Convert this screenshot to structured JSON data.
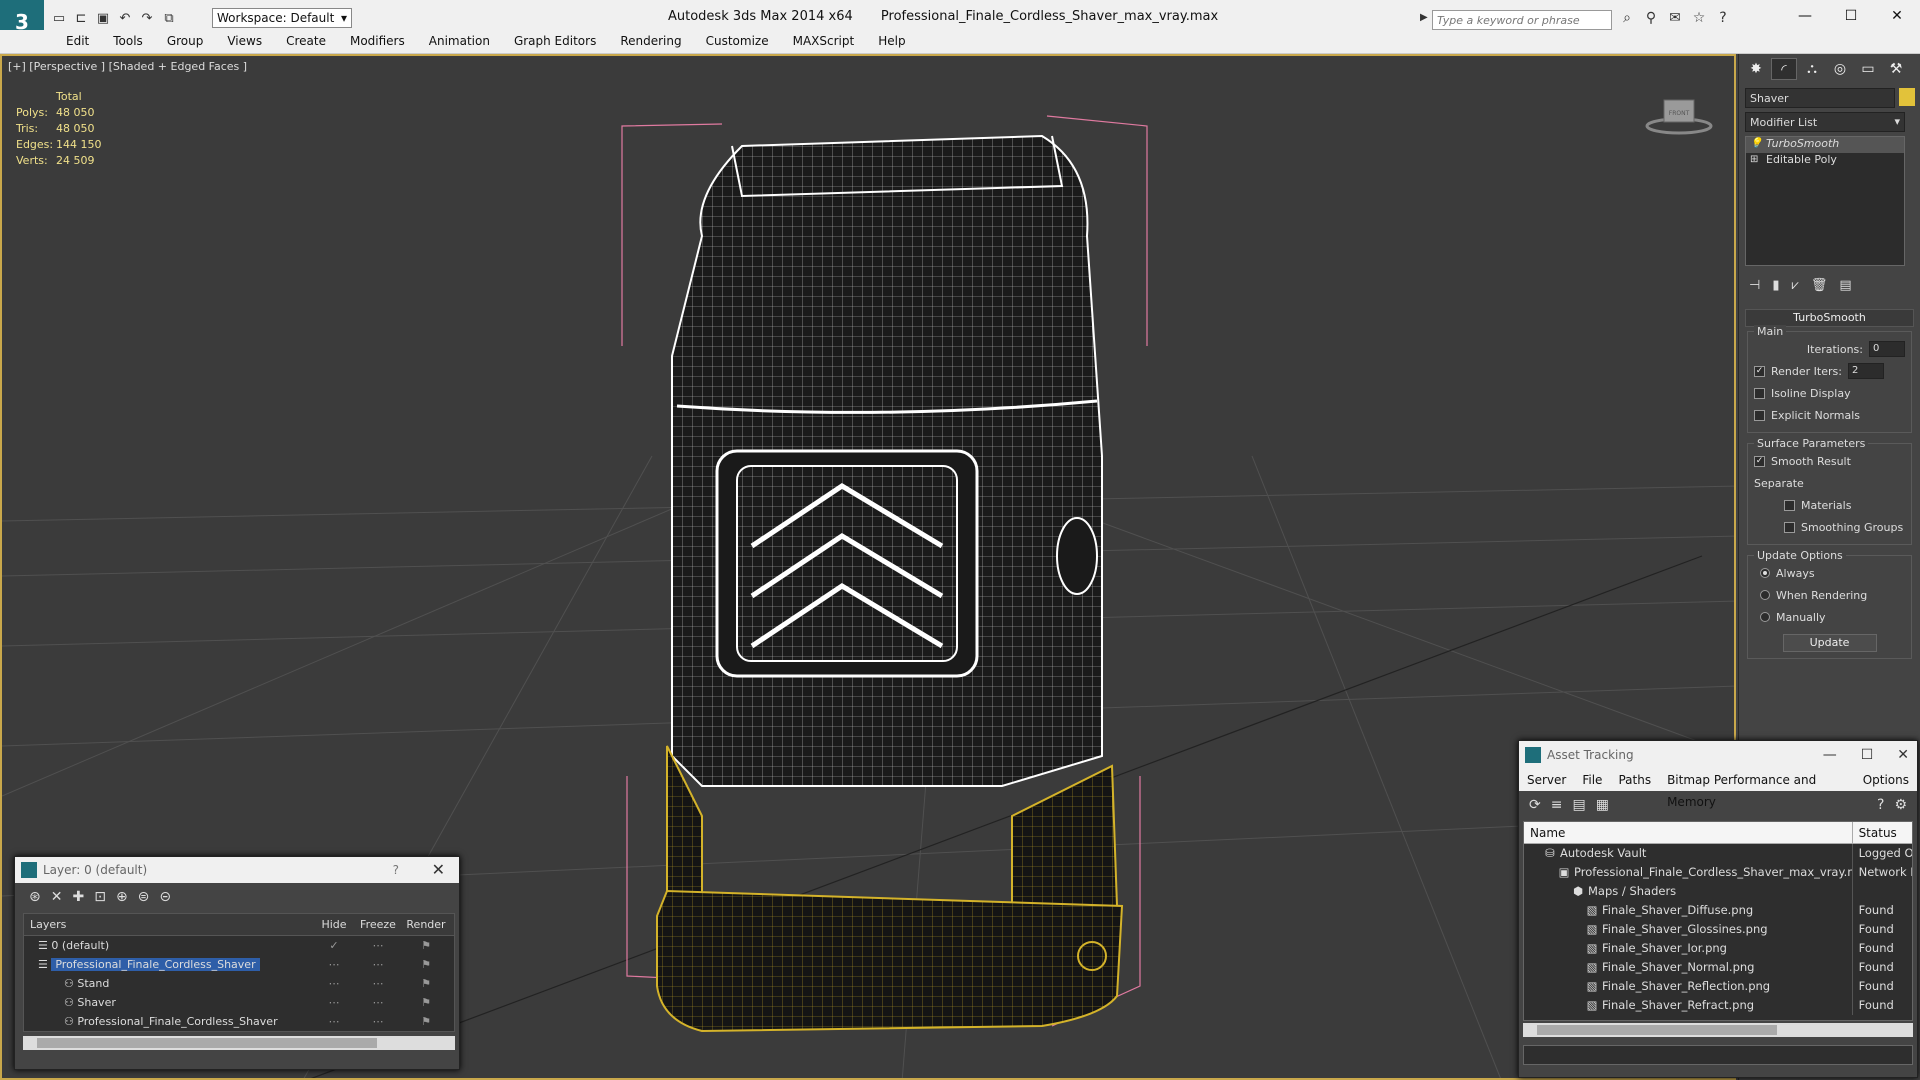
{
  "window": {
    "app_name": "Autodesk 3ds Max  2014 x64",
    "file_name": "Professional_Finale_Cordless_Shaver_max_vray.max",
    "workspace": "Workspace: Default",
    "search_placeholder": "Type a keyword or phrase"
  },
  "menu": [
    "Edit",
    "Tools",
    "Group",
    "Views",
    "Create",
    "Modifiers",
    "Animation",
    "Graph Editors",
    "Rendering",
    "Customize",
    "MAXScript",
    "Help"
  ],
  "viewport": {
    "label": "[+] [Perspective ] [Shaded + Edged Faces ]",
    "stats_header": "Total",
    "stats": [
      {
        "k": "Polys:",
        "v": "48 050"
      },
      {
        "k": "Tris:",
        "v": "48 050"
      },
      {
        "k": "Edges:",
        "v": "144 150"
      },
      {
        "k": "Verts:",
        "v": "24 509"
      }
    ],
    "viewcube_label": "FRONT"
  },
  "cmdpanel": {
    "object_name": "Shaver",
    "object_color": "#e2c23a",
    "modifier_list": "Modifier List",
    "stack": [
      "TurboSmooth",
      "Editable Poly"
    ],
    "rollout": "TurboSmooth",
    "main_label": "Main",
    "iterations_label": "Iterations:",
    "iterations": "0",
    "render_iters_label": "Render Iters:",
    "render_iters": "2",
    "isoline": "Isoline Display",
    "explicit_normals": "Explicit Normals",
    "surface_label": "Surface Parameters",
    "smooth_result": "Smooth Result",
    "separate_label": "Separate",
    "materials": "Materials",
    "smoothing_groups": "Smoothing Groups",
    "update_label": "Update Options",
    "always": "Always",
    "when_rendering": "When Rendering",
    "manually": "Manually",
    "update_btn": "Update"
  },
  "layer_dialog": {
    "title": "Layer: 0 (default)",
    "help": "?",
    "cols": {
      "layers": "Layers",
      "hide": "Hide",
      "freeze": "Freeze",
      "render": "Render"
    },
    "rows": [
      {
        "name": "0 (default)",
        "indent": 14
      },
      {
        "name": "Professional_Finale_Cordless_Shaver",
        "indent": 14
      },
      {
        "name": "Stand",
        "indent": 40
      },
      {
        "name": "Shaver",
        "indent": 40
      },
      {
        "name": "Professional_Finale_Cordless_Shaver",
        "indent": 40
      }
    ]
  },
  "asset_dialog": {
    "title": "Asset Tracking",
    "menu": [
      "Server",
      "File",
      "Paths",
      "Bitmap Performance and Memory",
      "Options"
    ],
    "col_name": "Name",
    "col_status": "Status",
    "rows": [
      {
        "name": "Autodesk Vault",
        "status": "Logged Out",
        "indent": 20
      },
      {
        "name": "Professional_Finale_Cordless_Shaver_max_vray.max",
        "status": "Network P",
        "indent": 34
      },
      {
        "name": "Maps / Shaders",
        "status": "",
        "indent": 48
      },
      {
        "name": "Finale_Shaver_Diffuse.png",
        "status": "Found",
        "indent": 62
      },
      {
        "name": "Finale_Shaver_Glossines.png",
        "status": "Found",
        "indent": 62
      },
      {
        "name": "Finale_Shaver_Ior.png",
        "status": "Found",
        "indent": 62
      },
      {
        "name": "Finale_Shaver_Normal.png",
        "status": "Found",
        "indent": 62
      },
      {
        "name": "Finale_Shaver_Reflection.png",
        "status": "Found",
        "indent": 62
      },
      {
        "name": "Finale_Shaver_Refract.png",
        "status": "Found",
        "indent": 62
      }
    ]
  }
}
